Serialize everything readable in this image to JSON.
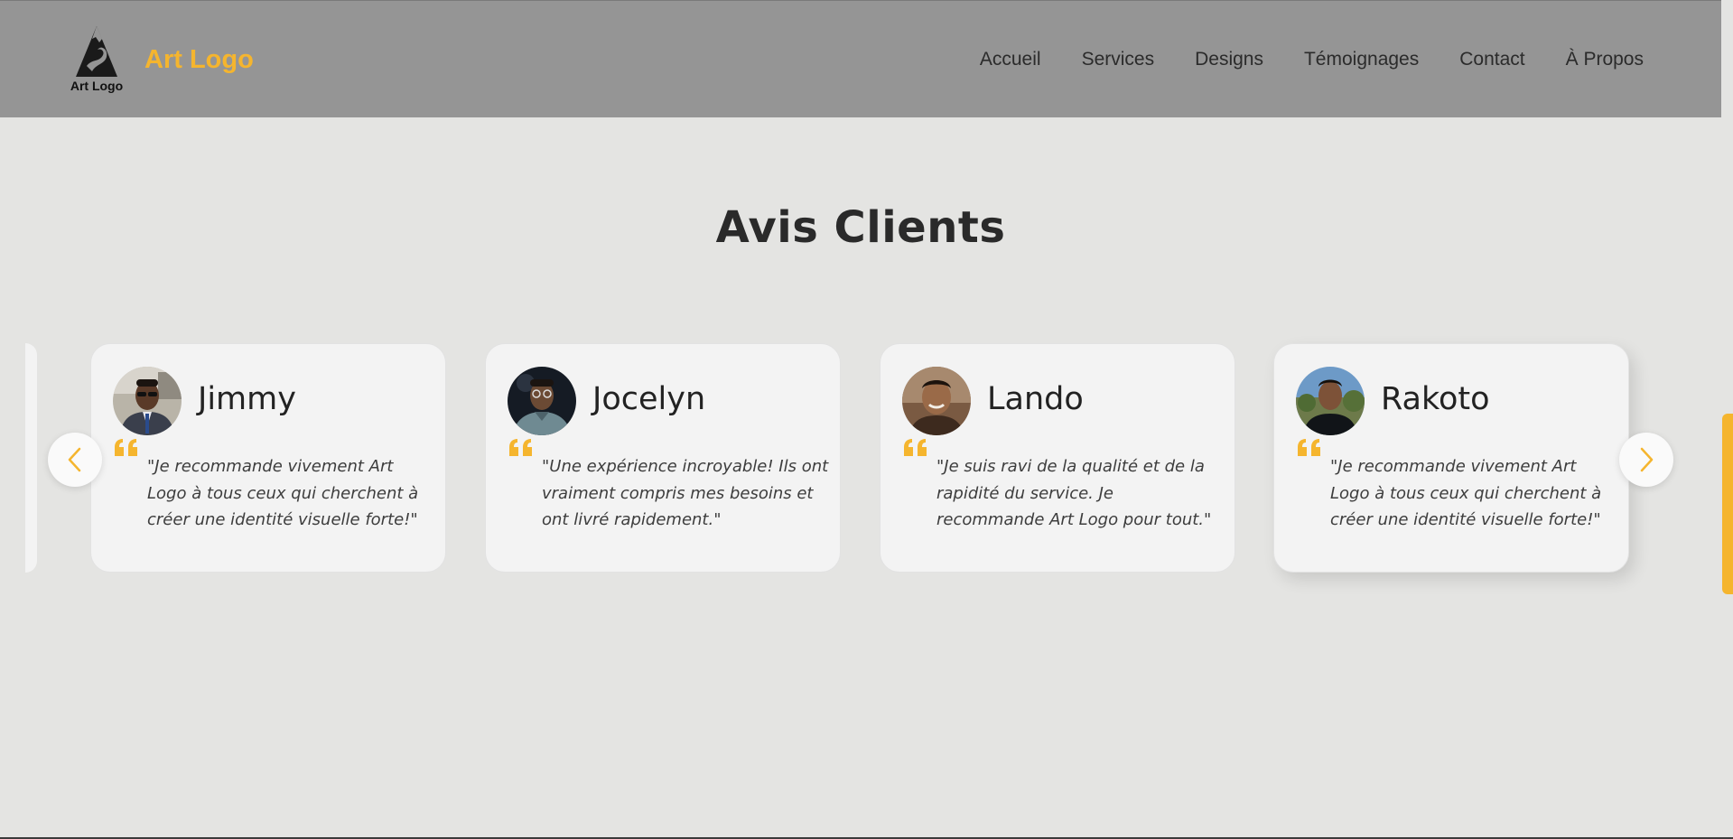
{
  "header": {
    "logo_caption": "Art Logo",
    "brand": "Art Logo",
    "nav": [
      "Accueil",
      "Services",
      "Designs",
      "Témoignages",
      "Contact",
      "À Propos"
    ]
  },
  "section": {
    "title": "Avis Clients"
  },
  "testimonials": [
    {
      "name": "Jimmy",
      "quote": "\"Je recommande vivement Art Logo à tous ceux qui cherchent à créer une identité visuelle forte!\""
    },
    {
      "name": "Jocelyn",
      "quote": "\"Une expérience incroyable! Ils ont vraiment compris mes besoins et ont livré rapidement.\""
    },
    {
      "name": "Lando",
      "quote": "\"Je suis ravi de la qualité et de la rapidité du service. Je recommande Art Logo pour tout.\""
    },
    {
      "name": "Rakoto",
      "quote": "\"Je recommande vivement Art Logo à tous ceux qui cherchent à créer une identité visuelle forte!\""
    }
  ],
  "icons": {
    "logo": "mountain-a-logo-icon",
    "quote": "quote-icon",
    "prev": "chevron-left-icon",
    "next": "chevron-right-icon"
  },
  "colors": {
    "accent": "#f5b52e",
    "header_bg": "#959595",
    "page_bg": "#e4e4e2",
    "card_bg": "#f3f3f3"
  }
}
